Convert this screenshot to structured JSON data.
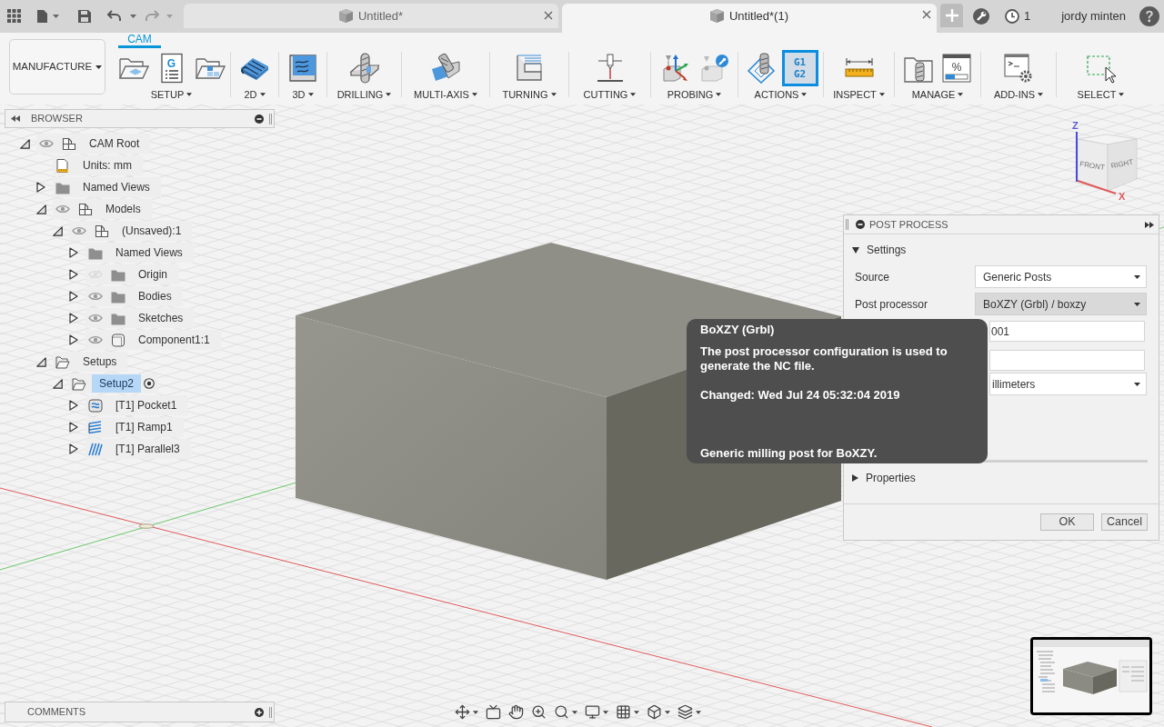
{
  "title_bar": {
    "tabs": [
      {
        "title": "Untitled*",
        "selected": false
      },
      {
        "title": "Untitled*(1)",
        "selected": true
      }
    ],
    "job_count": "1",
    "user": "jordy minten"
  },
  "toolbar": {
    "workspace": "MANUFACTURE",
    "tabs": [
      {
        "label": "CAM",
        "selected": true
      }
    ],
    "groups": [
      {
        "label": "SETUP",
        "tools": [
          {
            "selected": false
          },
          {
            "selected": false,
            "text": [
              "G"
            ]
          },
          {
            "selected": false
          }
        ]
      },
      {
        "label": "2D",
        "tools": [
          {
            "selected": false
          }
        ]
      },
      {
        "label": "3D",
        "tools": [
          {
            "selected": false
          }
        ]
      },
      {
        "label": "DRILLING",
        "tools": [
          {
            "selected": false
          }
        ]
      },
      {
        "label": "MULTI-AXIS",
        "tools": [
          {
            "selected": false
          }
        ]
      },
      {
        "label": "TURNING",
        "tools": [
          {
            "selected": false
          }
        ]
      },
      {
        "label": "CUTTING",
        "tools": [
          {
            "selected": false
          }
        ]
      },
      {
        "label": "PROBING",
        "tools": [
          {
            "selected": false
          },
          {
            "selected": false
          }
        ]
      },
      {
        "label": "ACTIONS",
        "tools": [
          {
            "selected": false
          },
          {
            "selected": true,
            "text": [
              "G1",
              "G2"
            ]
          }
        ]
      },
      {
        "label": "INSPECT",
        "tools": [
          {
            "selected": false
          }
        ]
      },
      {
        "label": "MANAGE",
        "tools": [
          {
            "selected": false
          },
          {
            "selected": false,
            "text": [
              "%"
            ]
          }
        ]
      },
      {
        "label": "ADD-INS",
        "tools": [
          {
            "selected": false
          }
        ]
      },
      {
        "label": "SELECT",
        "tools": [
          {
            "selected": false
          }
        ]
      }
    ]
  },
  "browser": {
    "title": "BROWSER",
    "tree": [
      {
        "label": "CAM Root",
        "kind": "component",
        "expanded": true,
        "visible": true,
        "selected": false,
        "children": [
          {
            "label": "Units: mm",
            "kind": "units",
            "selected": false
          },
          {
            "label": "Named Views",
            "kind": "folder",
            "expanded": false,
            "selected": false
          },
          {
            "label": "Models",
            "kind": "component",
            "expanded": true,
            "visible": true,
            "selected": false,
            "children": [
              {
                "label": "(Unsaved):1",
                "kind": "component",
                "expanded": true,
                "visible": true,
                "selected": false,
                "children": [
                  {
                    "label": "Named Views",
                    "kind": "folder",
                    "expanded": false,
                    "selected": false
                  },
                  {
                    "label": "Origin",
                    "kind": "folder",
                    "expanded": false,
                    "visible": false,
                    "selected": false
                  },
                  {
                    "label": "Bodies",
                    "kind": "folder",
                    "expanded": false,
                    "visible": true,
                    "selected": false
                  },
                  {
                    "label": "Sketches",
                    "kind": "folder",
                    "expanded": false,
                    "visible": true,
                    "selected": false
                  },
                  {
                    "label": "Component1:1",
                    "kind": "body",
                    "expanded": false,
                    "visible": true,
                    "selected": false
                  }
                ]
              }
            ]
          },
          {
            "label": "Setups",
            "kind": "setup-folder",
            "expanded": true,
            "selected": false,
            "children": [
              {
                "label": "Setup2",
                "kind": "setup",
                "expanded": true,
                "selected": true,
                "active": true,
                "children": [
                  {
                    "label": "[T1] Pocket1",
                    "kind": "pocket",
                    "expanded": false,
                    "selected": false
                  },
                  {
                    "label": "[T1] Ramp1",
                    "kind": "ramp",
                    "expanded": false,
                    "selected": false
                  },
                  {
                    "label": "[T1] Parallel3",
                    "kind": "parallel",
                    "expanded": false,
                    "selected": false
                  }
                ]
              }
            ]
          }
        ]
      }
    ]
  },
  "post_process": {
    "title": "POST PROCESS",
    "sections": [
      {
        "label": "Settings",
        "expanded": true,
        "rows": [
          {
            "kind": "select",
            "label": "Source",
            "value": "Generic Posts",
            "highlighted": false
          },
          {
            "kind": "select",
            "label": "Post processor",
            "value": "BoXZY (Grbl) / boxzy",
            "highlighted": true
          },
          {
            "kind": "text",
            "value": "001",
            "highlighted": false
          },
          {
            "kind": "text",
            "highlighted": false
          },
          {
            "kind": "select",
            "value": "illimeters",
            "highlighted": false
          }
        ]
      },
      {
        "label": "Properties",
        "expanded": false
      }
    ],
    "buttons": [
      "OK",
      "Cancel"
    ]
  },
  "tooltip": {
    "title": "BoXZY (Grbl)",
    "lines": [
      "The post processor configuration is used to generate the NC file.",
      "Changed: Wed Jul 24 05:32:04 2019",
      "Generic milling post for BoXZY."
    ]
  },
  "view_cube": {
    "faces": [
      "FRONT",
      "RIGHT"
    ],
    "axes": [
      "Z",
      "X"
    ]
  },
  "comments": {
    "title": "COMMENTS"
  }
}
